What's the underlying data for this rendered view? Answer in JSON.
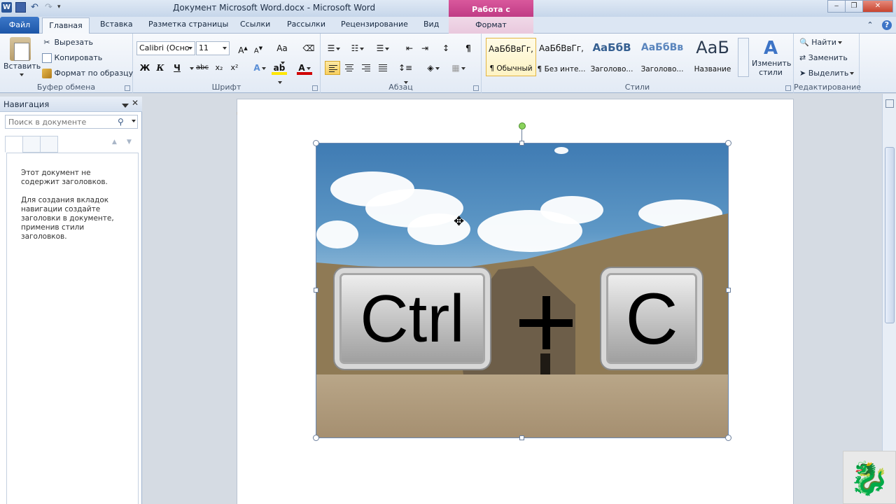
{
  "titlebar": {
    "title": "Документ Microsoft Word.docx  -  Microsoft Word",
    "context_group": "Работа с рисунками",
    "word_icon_letter": "W"
  },
  "tabs": {
    "file": "Файл",
    "home": "Главная",
    "insert": "Вставка",
    "layout": "Разметка страницы",
    "references": "Ссылки",
    "mailings": "Рассылки",
    "review": "Рецензирование",
    "view": "Вид",
    "format": "Формат"
  },
  "ribbon": {
    "clipboard": {
      "paste": "Вставить",
      "cut": "Вырезать",
      "copy": "Копировать",
      "format_painter": "Формат по образцу",
      "label": "Буфер обмена"
    },
    "font": {
      "font_name": "Calibri (Осно",
      "font_size": "11",
      "bold": "Ж",
      "italic": "К",
      "underline": "Ч",
      "strike": "abc",
      "subscript": "x₂",
      "superscript": "x²",
      "label": "Шрифт"
    },
    "paragraph": {
      "label": "Абзац"
    },
    "styles": {
      "label": "Стили",
      "items": [
        {
          "preview": "АаБбВвГг,",
          "name": "¶ Обычный"
        },
        {
          "preview": "АаБбВвГг,",
          "name": "¶ Без инте..."
        },
        {
          "preview": "АаБбВ",
          "name": "Заголово..."
        },
        {
          "preview": "АаБбВв",
          "name": "Заголово..."
        },
        {
          "preview": "АаБ",
          "name": "Название"
        }
      ],
      "change_styles": "Изменить стили"
    },
    "editing": {
      "label": "Редактирование",
      "find": "Найти",
      "replace": "Заменить",
      "select": "Выделить"
    }
  },
  "nav": {
    "title": "Навигация",
    "search_placeholder": "Поиск в документе",
    "message1": "Этот документ не содержит заголовков.",
    "message2": "Для создания вкладок навигации создайте заголовки в документе, применив стили заголовков."
  },
  "picture": {
    "key1": "Ctrl",
    "key2": "C"
  }
}
